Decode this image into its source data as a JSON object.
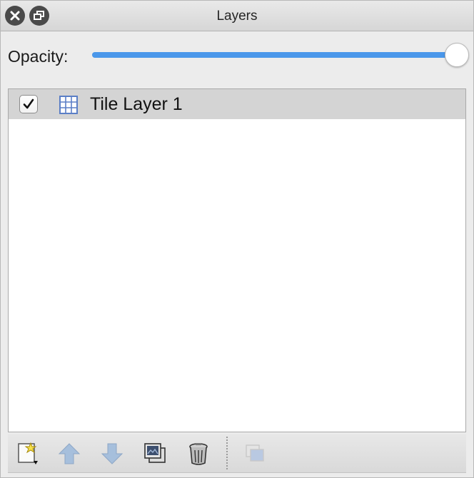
{
  "window": {
    "title": "Layers"
  },
  "opacity": {
    "label": "Opacity:",
    "value_fraction": 1.0,
    "accent_color": "#4a97ea"
  },
  "layers": [
    {
      "name": "Tile Layer 1",
      "visible": true,
      "type_icon": "tile-layer-icon",
      "selected": true
    }
  ],
  "toolbar": {
    "buttons": [
      {
        "icon": "new-layer-icon",
        "enabled": true
      },
      {
        "icon": "arrow-up-icon",
        "enabled": false
      },
      {
        "icon": "arrow-down-icon",
        "enabled": false
      },
      {
        "icon": "duplicate-layer-icon",
        "enabled": true
      },
      {
        "icon": "trash-icon",
        "enabled": true
      },
      {
        "icon": "merge-layers-icon",
        "enabled": false
      }
    ]
  }
}
